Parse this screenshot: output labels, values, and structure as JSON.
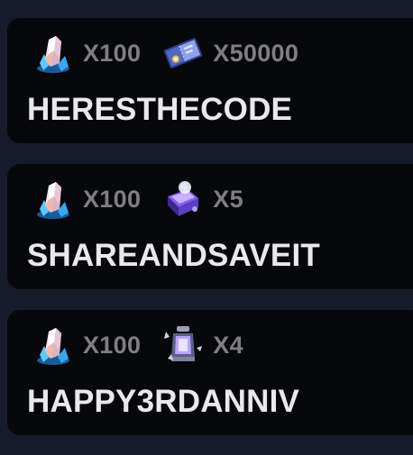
{
  "codes": [
    {
      "code": "HERESTHECODE",
      "rewards": [
        {
          "icon": "crystal-icon",
          "quantity": "X100"
        },
        {
          "icon": "ticket-icon",
          "quantity": "X50000"
        }
      ]
    },
    {
      "code": "SHAREANDSAVEIT",
      "rewards": [
        {
          "icon": "crystal-icon",
          "quantity": "X100"
        },
        {
          "icon": "spellbook-icon",
          "quantity": "X5"
        }
      ]
    },
    {
      "code": "HAPPY3RDANNIV",
      "rewards": [
        {
          "icon": "crystal-icon",
          "quantity": "X100"
        },
        {
          "icon": "lantern-icon",
          "quantity": "X4"
        }
      ]
    }
  ]
}
